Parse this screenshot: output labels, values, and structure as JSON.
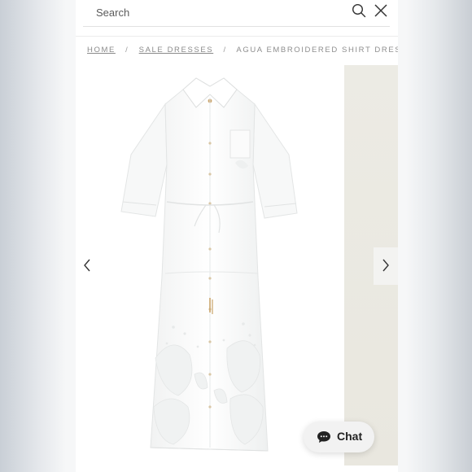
{
  "search": {
    "placeholder": "Search",
    "search_icon": "search-icon",
    "close_icon": "close-icon"
  },
  "breadcrumb": {
    "items": [
      {
        "label": "HOME"
      },
      {
        "label": "SALE DRESSES"
      }
    ],
    "separator": "/",
    "current": "AGUA EMBROIDERED SHIRT DRESS"
  },
  "gallery": {
    "prev_icon": "chevron-left-icon",
    "next_icon": "chevron-right-icon"
  },
  "chat": {
    "label": "Chat",
    "icon": "chat-bubble-icon"
  },
  "colors": {
    "page_background": "#ffffff",
    "dress": "#ffffff",
    "next_image": "#ecebe4",
    "chat_button": "#f2f2f2",
    "chat_icon": "#222222"
  }
}
